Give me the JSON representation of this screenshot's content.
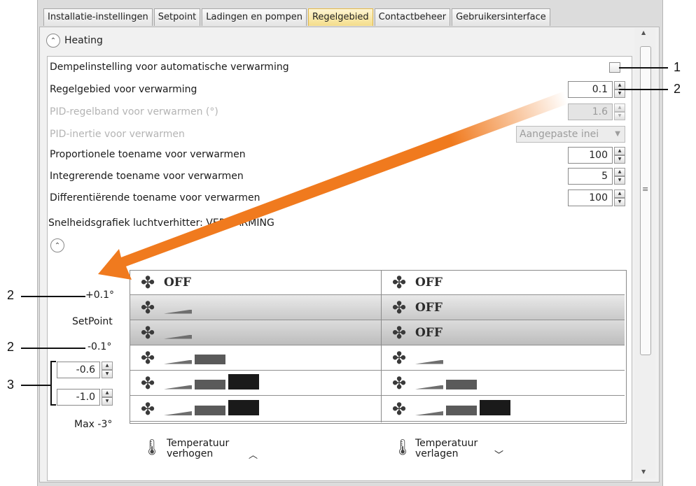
{
  "tabs": [
    "Installatie-instellingen",
    "Setpoint",
    "Ladingen en pompen",
    "Regelgebied",
    "Contactbeheer",
    "Gebruikersinterface"
  ],
  "active_tab": "Regelgebied",
  "section_title": "Heating",
  "settings": {
    "damper_label": "Dempelinstelling voor automatische verwarming",
    "range_label": "Regelgebied voor verwarming",
    "range_value": "0.1",
    "pid_band_label": "PID-regelband voor verwarmen (°)",
    "pid_band_value": "1.6",
    "pid_inertia_label": "PID-inertie voor verwarmen",
    "pid_inertia_value": "Aangepaste inei",
    "proportional_label": "Proportionele toename voor verwarmen",
    "proportional_value": "100",
    "integral_label": "Integrerende toename voor verwarmen",
    "integral_value": "5",
    "differential_label": "Differentiërende toename voor verwarmen",
    "differential_value": "100"
  },
  "graph_title": "Snelheidsgrafiek luchtverhitter: VERWARMING",
  "side": {
    "plus": "+0.1°",
    "setpoint": "SetPoint",
    "minus": "-0.1°",
    "input1": "-0.6",
    "input2": "-1.0",
    "max": "Max -3°"
  },
  "grid": {
    "off": "OFF",
    "left_levels": [
      "OFF",
      1,
      1,
      2,
      3,
      3
    ],
    "right_levels": [
      "OFF",
      "OFF",
      "OFF",
      1,
      2,
      3
    ]
  },
  "bottom": {
    "left_line1": "Temperatuur",
    "left_line2": "verhogen",
    "right_line1": "Temperatuur",
    "right_line2": "verlagen"
  },
  "annotations": {
    "n1": "1",
    "n2": "2",
    "n3": "3"
  },
  "colors": {
    "active_tab": "#f4dd8b",
    "arrow": "#f07a1e",
    "fan": "#3a3a3a"
  }
}
